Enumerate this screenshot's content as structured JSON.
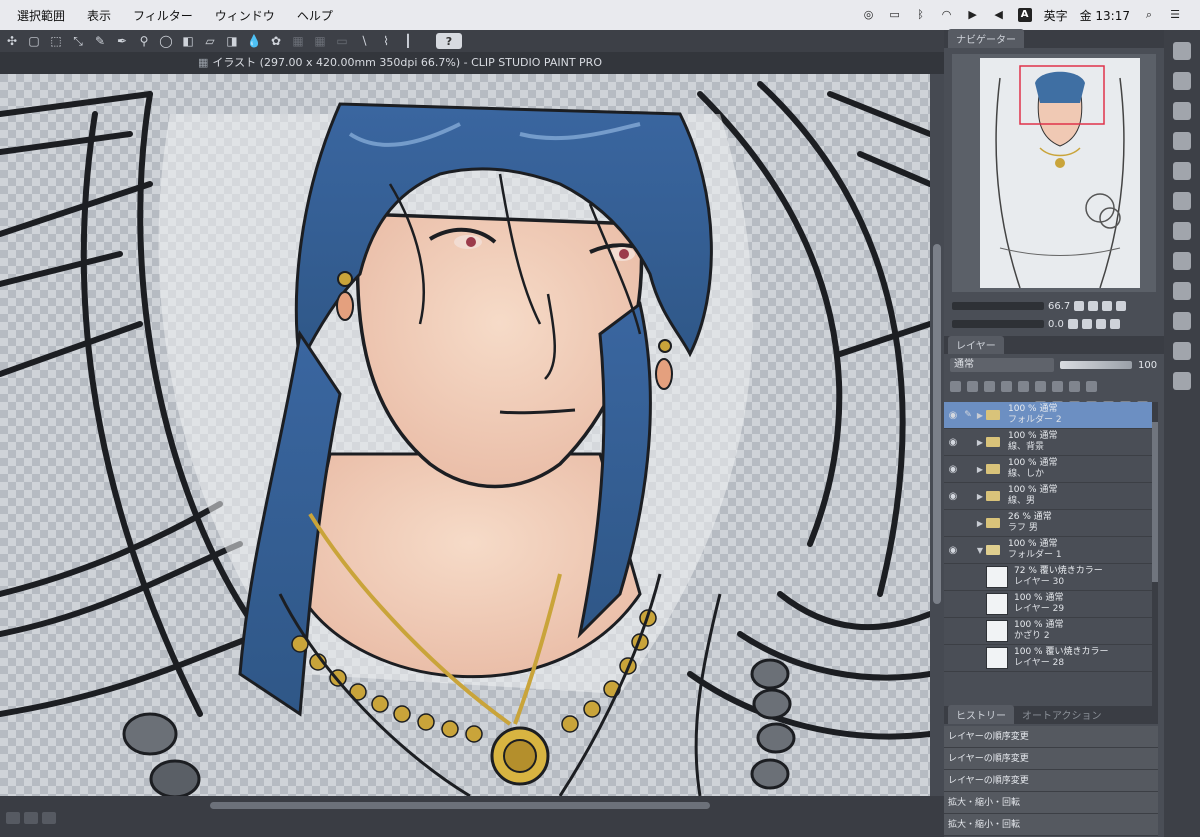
{
  "menubar": {
    "items": [
      "選択範囲",
      "表示",
      "フィルター",
      "ウィンドウ",
      "ヘルプ"
    ],
    "ime_label": "A",
    "ime_text": "英字",
    "clock": "金 13:17"
  },
  "window": {
    "title": "イラスト (297.00 x 420.00mm 350dpi 66.7%) - CLIP STUDIO PAINT PRO",
    "help_label": "?"
  },
  "navigator": {
    "tab": "ナビゲーター",
    "zoom_value": "66.7",
    "rotate_value": "0.0"
  },
  "layer_panel": {
    "tab": "レイヤー",
    "blend_mode": "通常",
    "opacity": "100",
    "layers": [
      {
        "line1": "100 % 通常",
        "line2": "フォルダー 2",
        "type": "folder",
        "selected": true
      },
      {
        "line1": "100 % 通常",
        "line2": "線、背景",
        "type": "folder",
        "selected": false
      },
      {
        "line1": "100 % 通常",
        "line2": "線、しか",
        "type": "folder",
        "selected": false
      },
      {
        "line1": "100 % 通常",
        "line2": "線、男",
        "type": "folder",
        "selected": false
      },
      {
        "line1": "26 % 通常",
        "line2": "ラフ 男",
        "type": "folder",
        "selected": false
      },
      {
        "line1": "100 % 通常",
        "line2": "フォルダー 1",
        "type": "folder-open",
        "selected": false
      },
      {
        "line1": "72 % 覆い焼きカラー",
        "line2": "レイヤー 30",
        "type": "raster",
        "selected": false
      },
      {
        "line1": "100 % 通常",
        "line2": "レイヤー 29",
        "type": "raster",
        "selected": false
      },
      {
        "line1": "100 % 通常",
        "line2": "かざり 2",
        "type": "raster",
        "selected": false
      },
      {
        "line1": "100 % 覆い焼きカラー",
        "line2": "レイヤー 28",
        "type": "raster",
        "selected": false
      }
    ]
  },
  "history_panel": {
    "tab": "ヒストリー",
    "tab2": "オートアクション",
    "items": [
      "レイヤーの順序変更",
      "レイヤーの順序変更",
      "レイヤーの順序変更",
      "拡大・縮小・回転",
      "拡大・縮小・回転"
    ]
  },
  "colors": {
    "hair": "#3f6fa3",
    "skin": "#f0c9b4",
    "gold": "#c9a43a",
    "line": "#1c1e22",
    "selected_layer": "#6c8fc2"
  }
}
